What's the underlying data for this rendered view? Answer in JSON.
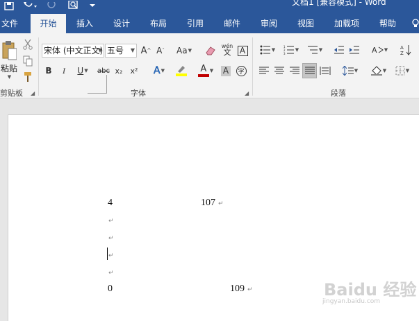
{
  "window": {
    "title": "文档1 [兼容模式] - Word"
  },
  "tabs": [
    "文件",
    "开始",
    "插入",
    "设计",
    "布局",
    "引用",
    "邮件",
    "审阅",
    "视图",
    "加载项",
    "帮助"
  ],
  "active_tab": "开始",
  "clipboard": {
    "paste_label": "粘贴",
    "group_label": "剪贴板"
  },
  "font": {
    "font_name": "宋体 (中文正文)",
    "font_size": "五号",
    "group_label": "字体",
    "change_case_label": "Aa",
    "char_border_label": "A",
    "phonetic_label": "wén",
    "bold": "B",
    "italic": "I",
    "underline": "U",
    "strike": "abc",
    "subscript": "x₂",
    "superscript": "x²",
    "text_effect": "A",
    "font_color_label": "A",
    "char_shading_label": "A",
    "enclose_label": "字",
    "highlight_color": "#ffff00",
    "font_color": "#c00000"
  },
  "paragraph": {
    "group_label": "段落"
  },
  "document": {
    "lines": [
      {
        "left": "4",
        "right": "107"
      },
      {
        "left": "",
        "right": ""
      },
      {
        "left": "",
        "right": ""
      },
      {
        "left": "",
        "right": ""
      },
      {
        "left": "",
        "right": ""
      },
      {
        "left": "0",
        "right": "109"
      }
    ],
    "paragraph_mark": "↵"
  },
  "watermark": {
    "text": "Baidu 经验",
    "sub": "jingyan.baidu.com"
  },
  "colors": {
    "accent": "#2b579a",
    "ribbon_bg": "#f3f3f3",
    "workspace_bg": "#e6e6e6"
  }
}
